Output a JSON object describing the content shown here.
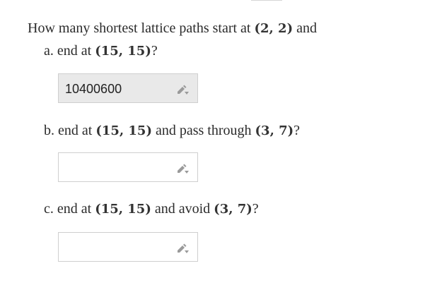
{
  "question": {
    "stem_text": "How many shortest lattice paths start at",
    "stem_point": "(2, 2)",
    "stem_tail": "and"
  },
  "parts": [
    {
      "prefix": "a. end at",
      "point": "(15, 15)",
      "suffix": "?",
      "answer": "10400600"
    },
    {
      "prefix": "b. end at",
      "point": "(15, 15)",
      "middle": "and pass through",
      "point2": "(3, 7)",
      "suffix": "?",
      "answer": ""
    },
    {
      "prefix": "c. end at",
      "point": "(15, 15)",
      "middle": "and avoid",
      "point2": "(3, 7)",
      "suffix": "?",
      "answer": ""
    }
  ],
  "icons": {
    "edit": "pencil-dropdown-icon"
  },
  "colors": {
    "text": "#2b2b2b",
    "filled_box": "#e9e9e9",
    "box_border": "#cfcfcf",
    "icon": "#9a9a9a"
  }
}
